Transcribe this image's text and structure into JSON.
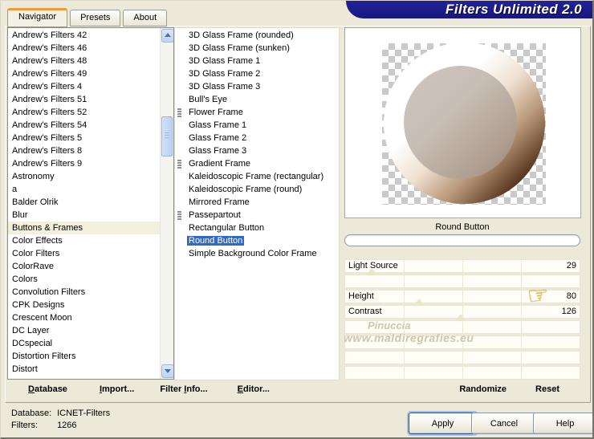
{
  "window": {
    "title": "Filters Unlimited 2.0"
  },
  "tabs": [
    {
      "label": "Navigator",
      "active": true
    },
    {
      "label": "Presets",
      "active": false
    },
    {
      "label": "About",
      "active": false
    }
  ],
  "categories": {
    "selected": "Buttons & Frames",
    "items": [
      "Andrew's Filters 42",
      "Andrew's Filters 46",
      "Andrew's Filters 48",
      "Andrew's Filters 49",
      "Andrew's Filters 4",
      "Andrew's Filters 51",
      "Andrew's Filters 52",
      "Andrew's Filters 54",
      "Andrew's Filters 5",
      "Andrew's Filters 8",
      "Andrew's Filters 9",
      "Astronomy",
      "a",
      "Balder Olrik",
      "Blur",
      "Buttons & Frames",
      "Color Effects",
      "Color Filters",
      "ColorRave",
      "Colors",
      "Convolution Filters",
      "CPK Designs",
      "Crescent Moon",
      "DC Layer",
      "DCspecial",
      "Distortion Filters",
      "Distort"
    ]
  },
  "filters": {
    "selected": "Round Button",
    "items": [
      {
        "label": "3D Glass Frame (rounded)",
        "icon": false
      },
      {
        "label": "3D Glass Frame (sunken)",
        "icon": false
      },
      {
        "label": "3D Glass Frame 1",
        "icon": false
      },
      {
        "label": "3D Glass Frame 2",
        "icon": false
      },
      {
        "label": "3D Glass Frame 3",
        "icon": false
      },
      {
        "label": "Bull's Eye",
        "icon": false
      },
      {
        "label": "Flower Frame",
        "icon": true
      },
      {
        "label": "Glass Frame 1",
        "icon": false
      },
      {
        "label": "Glass Frame 2",
        "icon": false
      },
      {
        "label": "Glass Frame 3",
        "icon": false
      },
      {
        "label": "Gradient Frame",
        "icon": true
      },
      {
        "label": "Kaleidoscopic Frame (rectangular)",
        "icon": false
      },
      {
        "label": "Kaleidoscopic Frame (round)",
        "icon": false
      },
      {
        "label": "Mirrored Frame",
        "icon": false
      },
      {
        "label": "Passepartout",
        "icon": true
      },
      {
        "label": "Rectangular Button",
        "icon": false
      },
      {
        "label": "Round Button",
        "icon": false
      },
      {
        "label": "Simple Background Color Frame",
        "icon": false
      }
    ]
  },
  "preview": {
    "caption": "Round Button"
  },
  "sliders": {
    "rows": [
      {
        "label": "Light Source",
        "value": 29,
        "has_thumb": true
      },
      {
        "label": "",
        "value": null,
        "has_thumb": false
      },
      {
        "label": "Height",
        "value": 80,
        "has_thumb": true
      },
      {
        "label": "Contrast",
        "value": 126,
        "has_thumb": true
      },
      {
        "label": "",
        "value": null,
        "has_thumb": false
      },
      {
        "label": "",
        "value": null,
        "has_thumb": false
      },
      {
        "label": "",
        "value": null,
        "has_thumb": false
      },
      {
        "label": "",
        "value": null,
        "has_thumb": false
      }
    ]
  },
  "watermark": {
    "line1": "Pinuccia",
    "line2": "www.maldiregrafies.eu"
  },
  "toolbar": {
    "items": [
      {
        "name": "database-button",
        "pre": "",
        "key": "D",
        "post": "atabase"
      },
      {
        "name": "import-button",
        "pre": "",
        "key": "I",
        "post": "mport..."
      },
      {
        "name": "filter-info-button",
        "pre": "Filter ",
        "key": "I",
        "post": "nfo..."
      },
      {
        "name": "editor-button",
        "pre": "",
        "key": "E",
        "post": "ditor..."
      },
      {
        "name": "randomize-button",
        "pre": "Randomize",
        "key": "",
        "post": ""
      },
      {
        "name": "reset-button",
        "pre": "Reset",
        "key": "",
        "post": ""
      }
    ]
  },
  "status": {
    "database_label": "Database:",
    "database_value": "ICNET-Filters",
    "filters_label": "Filters:",
    "filters_value": "1266"
  },
  "action_buttons": [
    "Apply",
    "Cancel",
    "Help"
  ],
  "icons": {
    "hand_pointer": "☞"
  },
  "colors": {
    "banner": "#1b1b8a",
    "selection_blue": "#316ac5",
    "tab_accent_orange": "#ef9c34",
    "dialog_face": "#ece9d8",
    "checker_gray": "#c9c9c9"
  }
}
